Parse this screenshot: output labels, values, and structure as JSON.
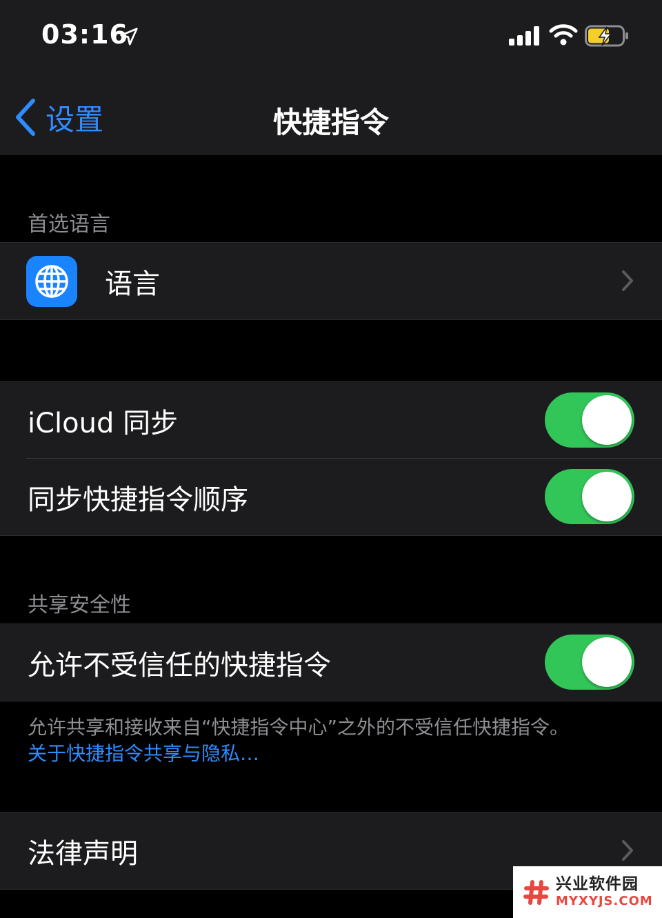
{
  "status_bar": {
    "time": "03:16"
  },
  "nav": {
    "back_label": "设置",
    "title": "快捷指令"
  },
  "section_language": {
    "header": "首选语言",
    "row_label": "语言"
  },
  "section_sync": {
    "rows": [
      {
        "label": "iCloud 同步",
        "enabled": true
      },
      {
        "label": "同步快捷指令顺序",
        "enabled": true
      }
    ]
  },
  "section_security": {
    "header": "共享安全性",
    "row_label": "允许不受信任的快捷指令",
    "enabled": true,
    "footer": "允许共享和接收来自“快捷指令中心”之外的不受信任快捷指令。",
    "footer_link": "关于快捷指令共享与隐私…"
  },
  "section_legal": {
    "row_label": "法律声明"
  },
  "watermark": {
    "name_cn": "兴业软件园",
    "name_en": "MYXYJS.COM"
  },
  "colors": {
    "accent_blue": "#2f8cff",
    "toggle_green": "#32c659",
    "cell_background": "#1c1c1e",
    "page_background": "#000000",
    "secondary_text": "#8e8e93"
  }
}
